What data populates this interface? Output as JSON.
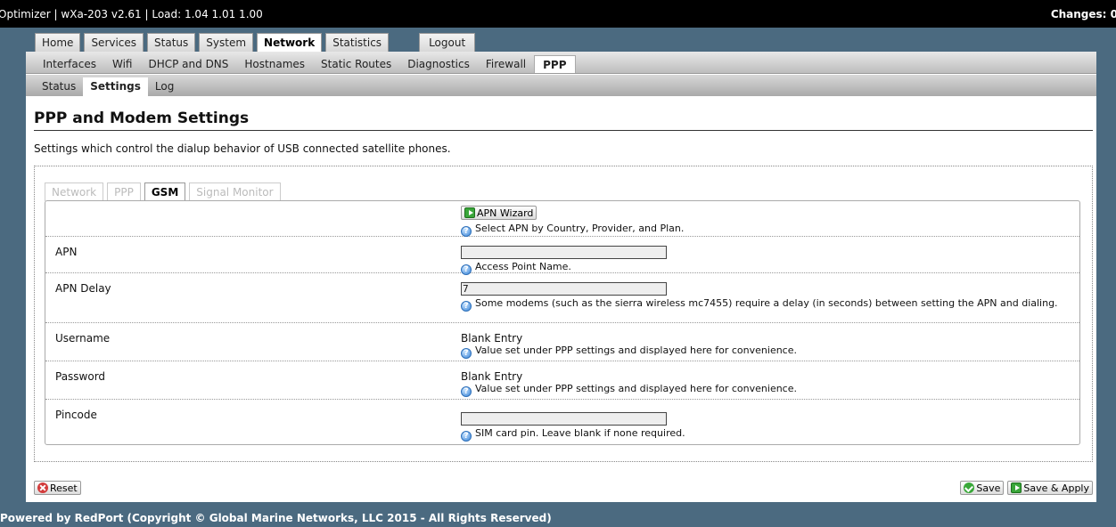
{
  "header": {
    "title": "Optimizer | wXa-203 v2.61 | Load: 1.04 1.01 1.00",
    "changes": "Changes: 0"
  },
  "menu": {
    "main_tabs": [
      "Home",
      "Services",
      "Status",
      "System",
      "Network",
      "Statistics"
    ],
    "active_main": "Network",
    "logout": "Logout",
    "network_tabs": [
      "Interfaces",
      "Wifi",
      "DHCP and DNS",
      "Hostnames",
      "Static Routes",
      "Diagnostics",
      "Firewall",
      "PPP"
    ],
    "active_network": "PPP",
    "ppp_tabs": [
      "Status",
      "Settings",
      "Log"
    ],
    "active_ppp": "Settings"
  },
  "page": {
    "title": "PPP and Modem Settings",
    "description": "Settings which control the dialup behavior of USB connected satellite phones."
  },
  "subtabs": [
    "Network",
    "PPP",
    "GSM",
    "Signal Monitor"
  ],
  "active_subtab": "GSM",
  "form": {
    "apn_wizard": {
      "button": "APN Wizard",
      "hint": "Select APN by Country, Provider, and Plan."
    },
    "apn": {
      "label": "APN",
      "value": "",
      "hint": "Access Point Name."
    },
    "apn_delay": {
      "label": "APN Delay",
      "value": "7",
      "hint": "Some modems (such as the sierra wireless mc7455) require a delay (in seconds) between setting the APN and dialing."
    },
    "username": {
      "label": "Username",
      "value": "Blank Entry",
      "hint": "Value set under PPP settings and displayed here for convenience."
    },
    "password": {
      "label": "Password",
      "value": "Blank Entry",
      "hint": "Value set under PPP settings and displayed here for convenience."
    },
    "pincode": {
      "label": "Pincode",
      "value": "",
      "hint": "SIM card pin. Leave blank if none required."
    }
  },
  "actions": {
    "reset": "Reset",
    "save": "Save",
    "save_apply": "Save & Apply"
  },
  "footer": "Powered by RedPort (Copyright © Global Marine Networks, LLC 2015 - All Rights Reserved)"
}
